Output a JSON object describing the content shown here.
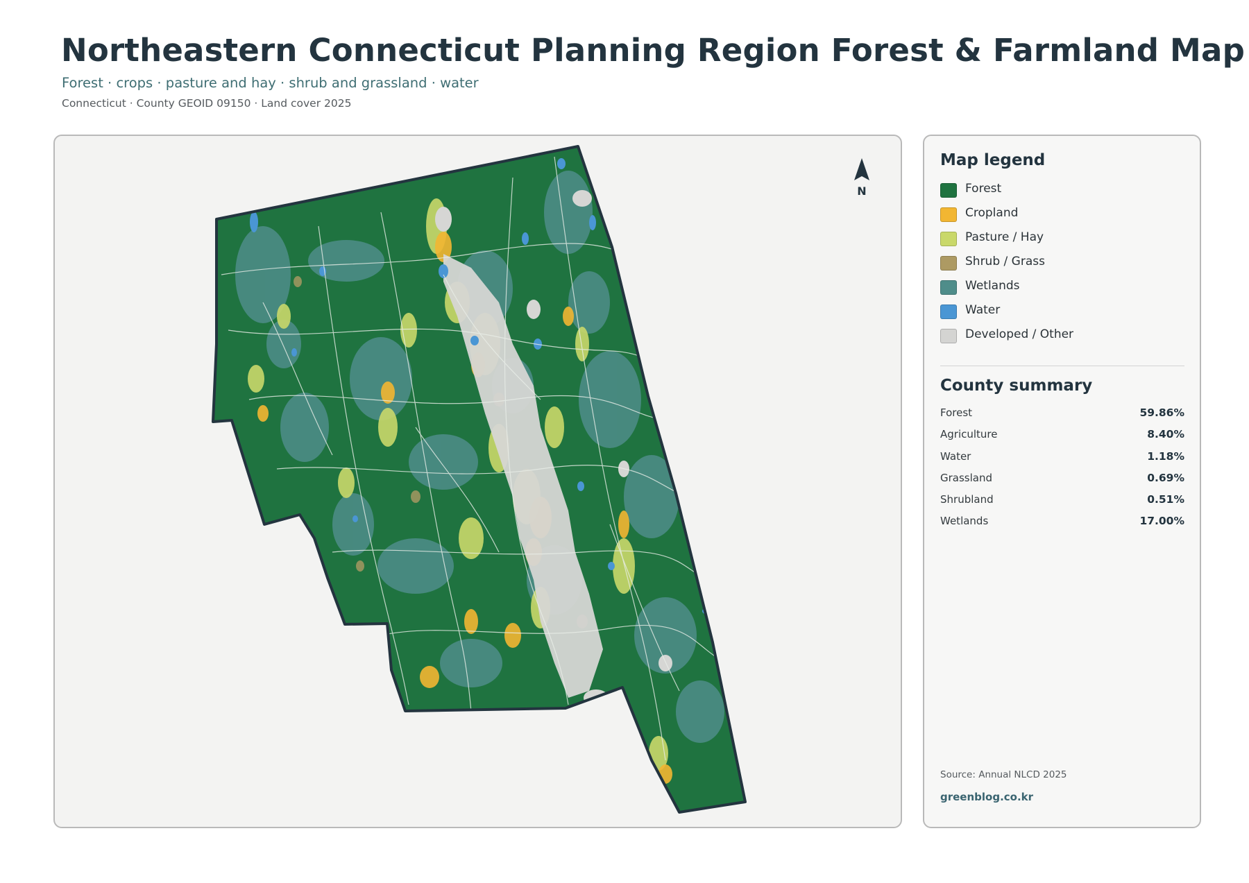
{
  "header": {
    "title": "Northeastern Connecticut Planning Region Forest & Farmland Map",
    "subtitle": "Forest · crops · pasture and hay · shrub and grassland · water",
    "meta": "Connecticut · County GEOID 09150 · Land cover 2025"
  },
  "map": {
    "north_label": "N",
    "colors": {
      "forest": "#1f7340",
      "cropland": "#f2b632",
      "pasture": "#c9d86a",
      "shrub": "#ad9a63",
      "wetlands": "#4f8d8a",
      "water": "#4a96d4",
      "developed": "#d6d6d4",
      "outline": "#23343f"
    }
  },
  "legend": {
    "heading": "Map legend",
    "items": [
      {
        "label": "Forest",
        "color": "#1f7340"
      },
      {
        "label": "Cropland",
        "color": "#f2b632"
      },
      {
        "label": "Pasture / Hay",
        "color": "#c9d86a"
      },
      {
        "label": "Shrub / Grass",
        "color": "#ad9a63"
      },
      {
        "label": "Wetlands",
        "color": "#4f8d8a"
      },
      {
        "label": "Water",
        "color": "#4a96d4"
      },
      {
        "label": "Developed / Other",
        "color": "#d4d4d2"
      }
    ]
  },
  "summary": {
    "heading": "County summary",
    "rows": [
      {
        "label": "Forest",
        "value": "59.86%"
      },
      {
        "label": "Agriculture",
        "value": "8.40%"
      },
      {
        "label": "Water",
        "value": "1.18%"
      },
      {
        "label": "Grassland",
        "value": "0.69%"
      },
      {
        "label": "Shrubland",
        "value": "0.51%"
      },
      {
        "label": "Wetlands",
        "value": "17.00%"
      }
    ]
  },
  "footer": {
    "source": "Source: Annual NLCD 2025",
    "site": "greenblog.co.kr"
  }
}
